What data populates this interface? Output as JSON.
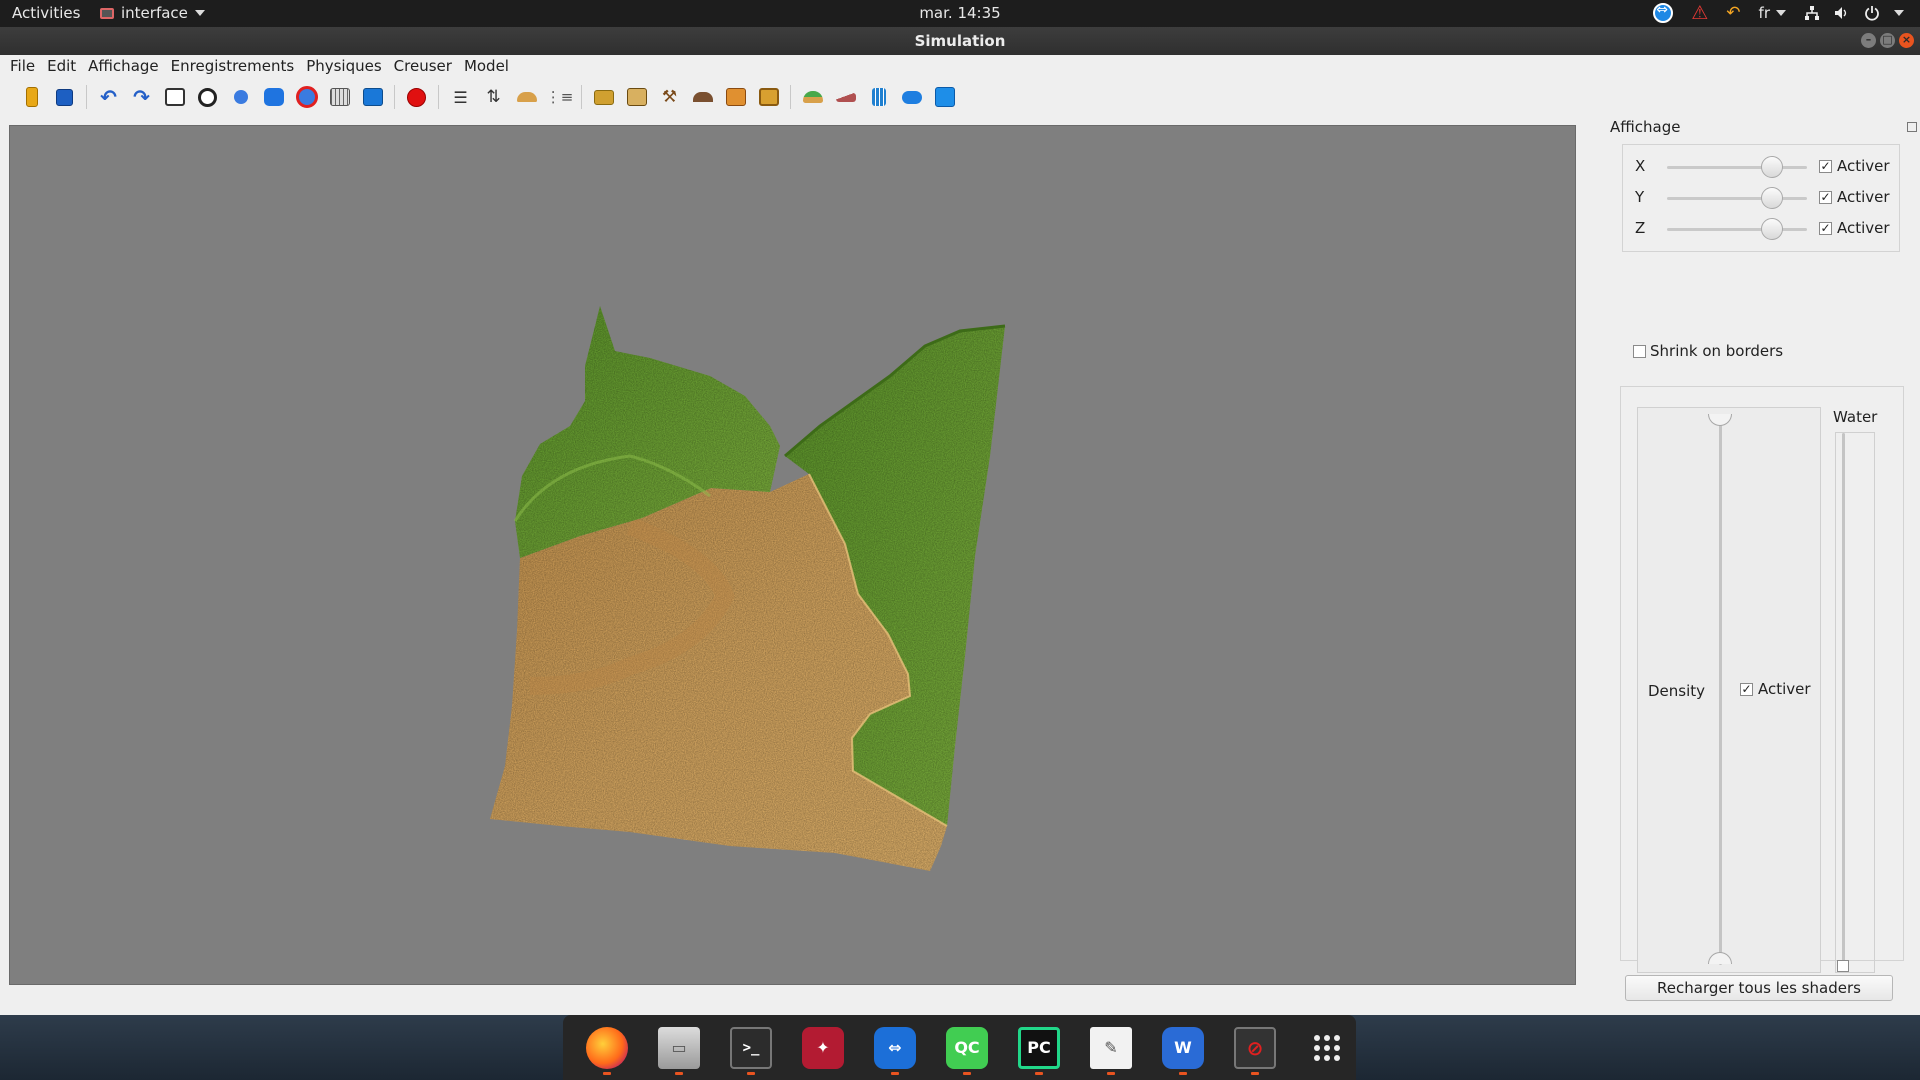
{
  "topbar": {
    "activities": "Activities",
    "app_name": "interface",
    "clock": "mar. 14:35",
    "language": "fr"
  },
  "window": {
    "title": "Simulation"
  },
  "menubar": {
    "items": [
      "File",
      "Edit",
      "Affichage",
      "Enregistrements",
      "Physiques",
      "Creuser",
      "Model"
    ]
  },
  "toolbar": {
    "icons": [
      "open-icon",
      "save-icon",
      "undo-icon",
      "redo-icon",
      "cursor-select-icon",
      "rotate-icon",
      "sphere-icon",
      "cubes-icon",
      "no-entry-icon",
      "grid-icon",
      "box-icon",
      "record-icon",
      "sliders-icon",
      "height-arrows-icon",
      "terrain-icon",
      "filter-icon",
      "folder-icon",
      "curve-icon",
      "hammer-icon",
      "shovel-icon",
      "crate-icon",
      "crate-2-icon",
      "island-icon",
      "slope-icon",
      "chart-icon",
      "cloud-icon",
      "water-volume-icon"
    ]
  },
  "panel": {
    "title": "Affichage",
    "axes": [
      {
        "label": "X",
        "value": 0.75,
        "checked": true,
        "check_label": "Activer"
      },
      {
        "label": "Y",
        "value": 0.75,
        "checked": true,
        "check_label": "Activer"
      },
      {
        "label": "Z",
        "value": 0.75,
        "checked": true,
        "check_label": "Activer"
      }
    ],
    "shrink_label": "Shrink on borders",
    "shrink_checked": false,
    "density_label": "Density",
    "density_check_label": "Activer",
    "density_checked": true,
    "water_label": "Water",
    "water_level": 0.0,
    "reload_button": "Recharger tous les shaders"
  },
  "dock": {
    "apps": [
      "firefox-icon",
      "files-icon",
      "terminal-icon",
      "mendeley-icon",
      "teamviewer-icon",
      "qtcreator-icon",
      "pycharm-icon",
      "text-editor-icon",
      "wps-icon",
      "blocked-app-icon",
      "show-apps-icon"
    ],
    "qc_label": "QC",
    "pc_label": "PC",
    "wps_label": "W"
  },
  "colors": {
    "grass": "#6aa333",
    "sand": "#d6a45d",
    "viewport_bg": "#7f7f7f"
  }
}
